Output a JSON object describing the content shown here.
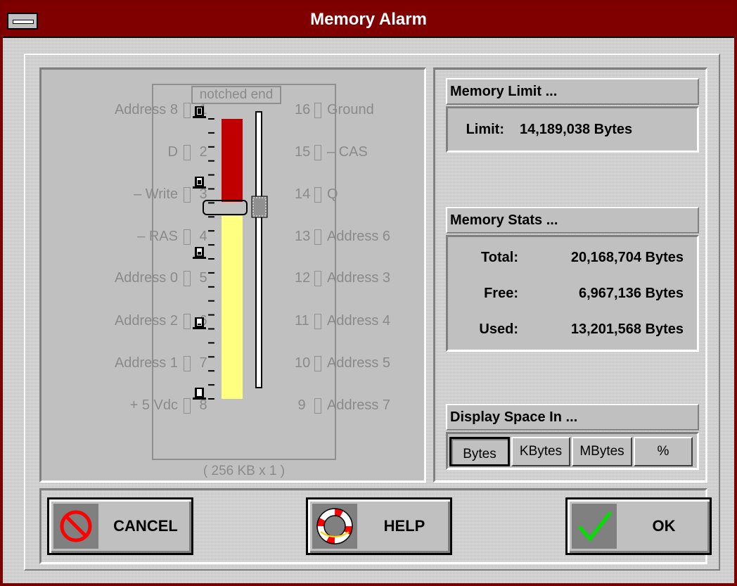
{
  "window": {
    "title": "Memory Alarm",
    "title_bg": "#800000"
  },
  "chip": {
    "notch_label": "notched end",
    "spec_label": "( 256 KB x 1 )",
    "left_pins": [
      {
        "label": "Address 8",
        "num": "1"
      },
      {
        "label": "D",
        "num": "2"
      },
      {
        "label": "– Write",
        "num": "3"
      },
      {
        "label": "– RAS",
        "num": "4"
      },
      {
        "label": "Address 0",
        "num": "5"
      },
      {
        "label": "Address 2",
        "num": "6"
      },
      {
        "label": "Address 1",
        "num": "7"
      },
      {
        "label": "+ 5 Vdc",
        "num": "8"
      }
    ],
    "right_pins": [
      {
        "num": "16",
        "label": "Ground"
      },
      {
        "num": "15",
        "label": "– CAS"
      },
      {
        "num": "14",
        "label": "Q"
      },
      {
        "num": "13",
        "label": "Address 6"
      },
      {
        "num": "12",
        "label": "Address 3"
      },
      {
        "num": "11",
        "label": "Address 4"
      },
      {
        "num": "10",
        "label": "Address 5"
      },
      {
        "num": "9",
        "label": "Address 7"
      }
    ]
  },
  "gauge": {
    "used_fraction": 0.654,
    "limit_fraction": 0.704,
    "used_color": "#c00000",
    "free_color": "#ffff80",
    "icons": [
      "fuel-full-icon",
      "fuel-three-quarter-icon",
      "fuel-half-icon",
      "fuel-quarter-icon",
      "fuel-empty-icon"
    ]
  },
  "memory_limit": {
    "header": "Memory Limit ...",
    "label": "Limit:",
    "value": "14,189,038 Bytes"
  },
  "memory_stats": {
    "header": "Memory Stats ...",
    "rows": [
      {
        "label": "Total:",
        "value": "20,168,704 Bytes"
      },
      {
        "label": "Free:",
        "value": "6,967,136 Bytes"
      },
      {
        "label": "Used:",
        "value": "13,201,568 Bytes"
      }
    ]
  },
  "display_space": {
    "header": "Display Space In ...",
    "options": [
      "Bytes",
      "KBytes",
      "MBytes",
      "%"
    ],
    "selected": "Bytes"
  },
  "buttons": {
    "cancel": {
      "label": "CANCEL",
      "icon": "no-entry-icon"
    },
    "help": {
      "label": "HELP",
      "icon": "life-preserver-icon"
    },
    "ok": {
      "label": "OK",
      "icon": "checkmark-icon"
    }
  }
}
